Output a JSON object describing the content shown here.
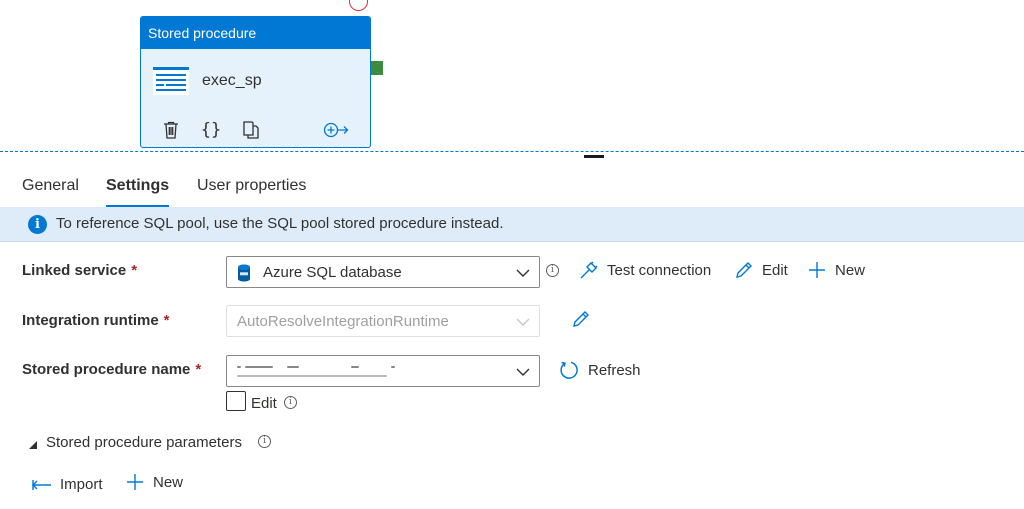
{
  "activity": {
    "type_label": "Stored procedure",
    "name": "exec_sp",
    "tools": [
      "delete-icon",
      "code-icon",
      "copy-icon",
      "add-output-icon"
    ]
  },
  "tabs": [
    {
      "label": "General"
    },
    {
      "label": "Settings"
    },
    {
      "label": "User properties"
    }
  ],
  "info_banner": {
    "text": "To reference SQL pool, use the SQL pool stored procedure instead."
  },
  "form": {
    "linked_service": {
      "label": "Linked service",
      "required": "*",
      "value": "Azure SQL database",
      "actions": {
        "test_connection": "Test connection",
        "edit": "Edit",
        "new": "New"
      }
    },
    "integration_runtime": {
      "label": "Integration runtime",
      "required": "*",
      "value": "AutoResolveIntegrationRuntime"
    },
    "stored_procedure_name": {
      "label": "Stored procedure name",
      "required": "*",
      "refresh": "Refresh",
      "edit_checkbox_label": "Edit"
    },
    "parameters": {
      "section_label": "Stored procedure parameters",
      "import": "Import",
      "new": "New"
    }
  },
  "colors": {
    "accent": "#0078d4",
    "success_port": "#3d8b40",
    "error_ring": "#d13438",
    "info_bar": "#deecf9",
    "required": "#a4262c"
  }
}
